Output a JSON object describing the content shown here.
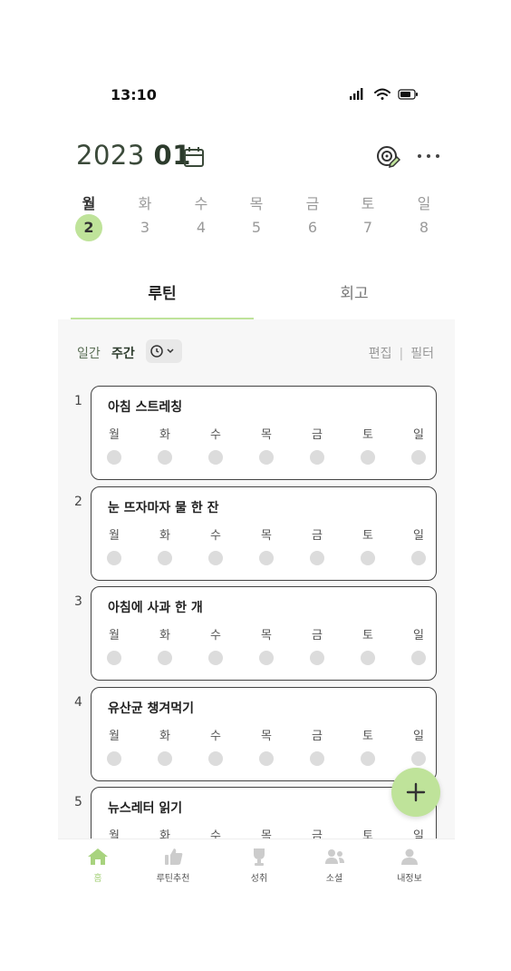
{
  "status": {
    "time": "13:10"
  },
  "header": {
    "year": "2023",
    "month": "01"
  },
  "week": [
    {
      "day": "월",
      "date": "2",
      "active": true
    },
    {
      "day": "화",
      "date": "3"
    },
    {
      "day": "수",
      "date": "4"
    },
    {
      "day": "목",
      "date": "5"
    },
    {
      "day": "금",
      "date": "6"
    },
    {
      "day": "토",
      "date": "7"
    },
    {
      "day": "일",
      "date": "8"
    }
  ],
  "tabs": {
    "routine": "루틴",
    "retro": "회고"
  },
  "filters": {
    "weekly": "일간",
    "daily": "주간",
    "edit": "편집",
    "filter": "필터"
  },
  "routine_days": [
    "월",
    "화",
    "수",
    "목",
    "금",
    "토",
    "일"
  ],
  "routines": [
    {
      "num": "1",
      "title": "아침 스트레칭"
    },
    {
      "num": "2",
      "title": "눈 뜨자마자 물 한 잔"
    },
    {
      "num": "3",
      "title": "아침에 사과 한 개"
    },
    {
      "num": "4",
      "title": "유산균 챙겨먹기"
    },
    {
      "num": "5",
      "title": "뉴스레터 읽기"
    }
  ],
  "fab": {
    "label": "+"
  },
  "nav": {
    "home": "홈",
    "recommend": "루틴추천",
    "achieve": "성취",
    "social": "소셜",
    "profile": "내정보",
    "active_color": "#a8d37e",
    "icon_color": "#cccccc"
  },
  "colors": {
    "accent": "#bfe39a"
  }
}
